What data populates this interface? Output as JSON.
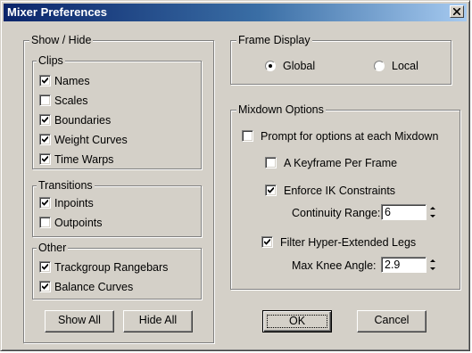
{
  "window": {
    "title": "Mixer Preferences"
  },
  "show_hide": {
    "legend": "Show / Hide",
    "clips": {
      "legend": "Clips",
      "items": [
        {
          "label": "Names",
          "checked": true
        },
        {
          "label": "Scales",
          "checked": false
        },
        {
          "label": "Boundaries",
          "checked": true
        },
        {
          "label": "Weight Curves",
          "checked": true
        },
        {
          "label": "Time Warps",
          "checked": true
        }
      ]
    },
    "transitions": {
      "legend": "Transitions",
      "items": [
        {
          "label": "Inpoints",
          "checked": true
        },
        {
          "label": "Outpoints",
          "checked": false
        }
      ]
    },
    "other": {
      "legend": "Other",
      "items": [
        {
          "label": "Trackgroup Rangebars",
          "checked": true
        },
        {
          "label": "Balance Curves",
          "checked": true
        }
      ]
    },
    "show_all_label": "Show All",
    "hide_all_label": "Hide All"
  },
  "frame_display": {
    "legend": "Frame Display",
    "options": [
      {
        "label": "Global",
        "selected": true
      },
      {
        "label": "Local",
        "selected": false
      }
    ]
  },
  "mixdown": {
    "legend": "Mixdown Options",
    "prompt": {
      "label": "Prompt for options at each Mixdown",
      "checked": false
    },
    "keyframe_per_frame": {
      "label": "A Keyframe Per Frame",
      "checked": false
    },
    "enforce_ik": {
      "label": "Enforce IK Constraints",
      "checked": true
    },
    "continuity_range": {
      "label": "Continuity Range:",
      "value": "6"
    },
    "filter_legs": {
      "label": "Filter Hyper-Extended Legs",
      "checked": true
    },
    "max_knee_angle": {
      "label": "Max Knee Angle:",
      "value": "2.9"
    }
  },
  "buttons": {
    "ok": "OK",
    "cancel": "Cancel"
  }
}
